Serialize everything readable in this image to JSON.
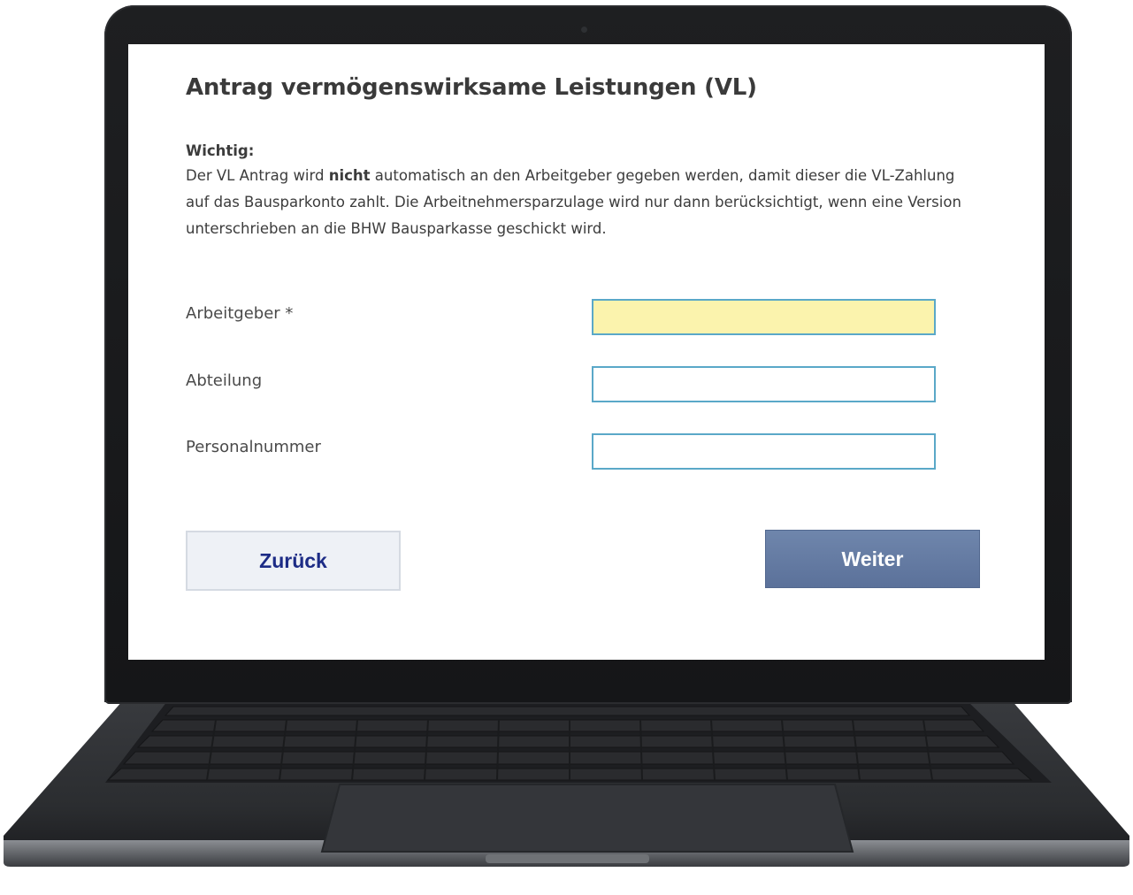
{
  "form": {
    "title": "Antrag vermögenswirksame Leistungen (VL)",
    "notice": {
      "heading": "Wichtig:",
      "text_before_bold": "Der VL Antrag wird ",
      "bold": "nicht",
      "text_after_bold": " automatisch an den Arbeitgeber gegeben werden, damit dieser die VL-Zahlung auf das Bausparkonto zahlt. Die Arbeitnehmersparzulage wird nur dann berücksichtigt, wenn eine Version unterschrieben an die BHW Bausparkasse geschickt wird."
    },
    "fields": {
      "employer": {
        "label": "Arbeitgeber *",
        "value": "",
        "required": true
      },
      "department": {
        "label": "Abteilung",
        "value": ""
      },
      "personnel_number": {
        "label": "Personalnummer",
        "value": ""
      }
    },
    "buttons": {
      "back": "Zurück",
      "next": "Weiter"
    }
  },
  "colors": {
    "required_field_background": "#fbf3ad",
    "input_border": "#5aa8c8",
    "back_button_text": "#1d2c86",
    "next_button_background": "#6479a3"
  }
}
